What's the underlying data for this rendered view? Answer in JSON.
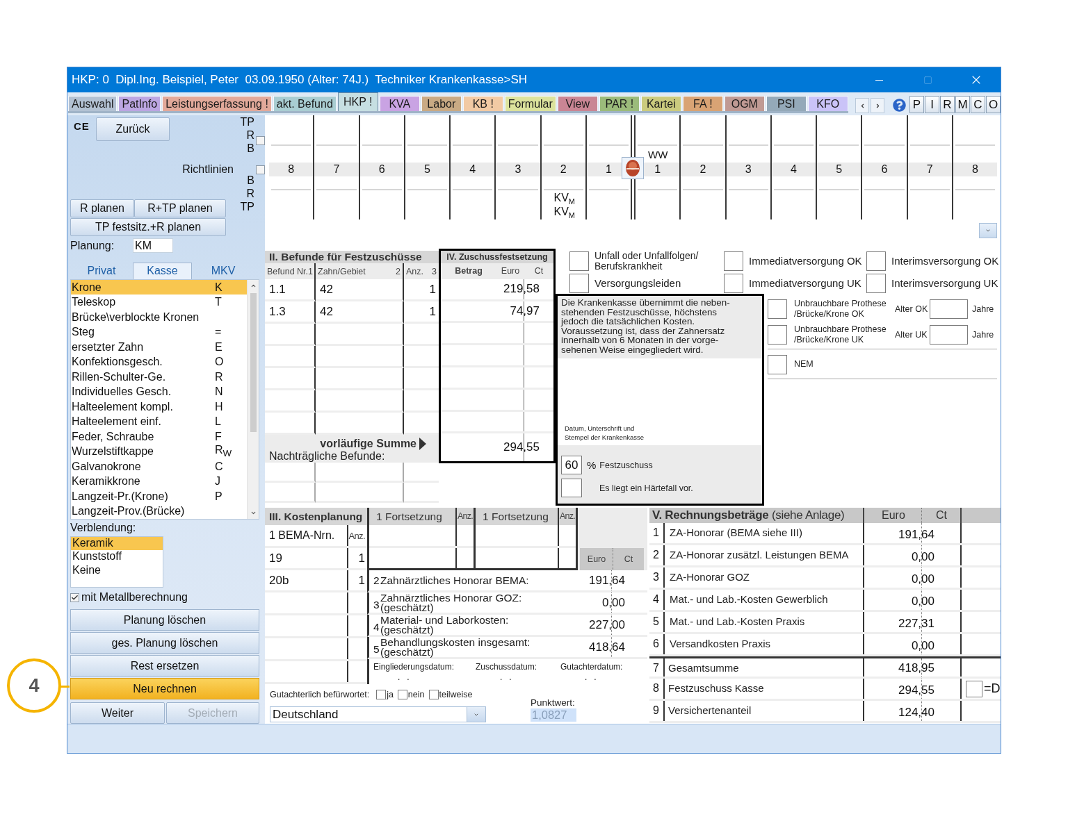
{
  "window": {
    "title": "HKP: 0  Dipl.Ing. Beispiel, Peter  03.09.1950 (Alter: 74J.)  Techniker Krankenkasse>SH"
  },
  "tabs": [
    {
      "label": "Auswahl",
      "color": "#b3c2d3",
      "selected": false
    },
    {
      "label": "PatInfo",
      "color": "#bca6e2",
      "selected": false
    },
    {
      "label": "Leistungserfassung !",
      "color": "#e2a99a",
      "selected": false
    },
    {
      "label": "akt. Befund",
      "color": "#a9cdd2",
      "selected": false
    },
    {
      "label": "HKP !",
      "color": "#c6dfe2",
      "selected": true
    },
    {
      "label": "KVA",
      "color": "#c9a3e3",
      "selected": false
    },
    {
      "label": "Labor",
      "color": "#c9aa84",
      "selected": false
    },
    {
      "label": "KB !",
      "color": "#f2caa4",
      "selected": false
    },
    {
      "label": "Formular",
      "color": "#dbe29c",
      "selected": false
    },
    {
      "label": "View",
      "color": "#c98594",
      "selected": false
    },
    {
      "label": "PAR !",
      "color": "#9bbb7b",
      "selected": false
    },
    {
      "label": "Kartei",
      "color": "#cbcb7e",
      "selected": false
    },
    {
      "label": "FA !",
      "color": "#d9a374",
      "selected": false
    },
    {
      "label": "OGM",
      "color": "#c09a94",
      "selected": false
    },
    {
      "label": "PSI",
      "color": "#94a9b9",
      "selected": false
    },
    {
      "label": "KFO",
      "color": "#cac3f8",
      "selected": false
    }
  ],
  "side_buttons": [
    "P",
    "I",
    "R",
    "M",
    "C",
    "O"
  ],
  "left_panel": {
    "ce_mark": "CE",
    "back_button": "Zurück",
    "upper_labels": [
      "TP",
      "R",
      "B"
    ],
    "upper_checkbox": {
      "checked": false
    },
    "guidelines": {
      "label": "Richtlinien",
      "checked": false
    },
    "lower_labels": [
      "B",
      "R",
      "TP"
    ],
    "plan_buttons": [
      "R planen",
      "R+TP planen",
      "TP festsitz.+R planen"
    ],
    "planning": {
      "label": "Planung:",
      "value": "KM"
    },
    "list_tabs": [
      {
        "label": "Privat",
        "selected": false
      },
      {
        "label": "Kasse",
        "selected": true
      },
      {
        "label": "MKV",
        "selected": false
      }
    ],
    "items": [
      {
        "name": "Krone",
        "code": "K",
        "selected": true
      },
      {
        "name": "Teleskop",
        "code": "T",
        "selected": false
      },
      {
        "name": "Brücke\\verblockte Kronen",
        "selected": false
      },
      {
        "name": "Steg",
        "code": "=",
        "selected": false
      },
      {
        "name": "ersetzter Zahn",
        "code": "E",
        "selected": false
      },
      {
        "name": "Konfektionsgesch.",
        "code": "O",
        "selected": false
      },
      {
        "name": "Rillen-Schulter-Ge.",
        "code": "R",
        "selected": false
      },
      {
        "name": "Individuelles Gesch.",
        "code": "N",
        "selected": false
      },
      {
        "name": "Halteelement kompl.",
        "code": "H",
        "selected": false
      },
      {
        "name": "Halteelement einf.",
        "code": "L",
        "selected": false
      },
      {
        "name": "Feder, Schraube",
        "code": "F",
        "selected": false
      },
      {
        "name": "Wurzelstiftkappe",
        "code": "R$_{W}$",
        "selected": false
      },
      {
        "name": "Galvanokrone",
        "code": "C",
        "selected": false
      },
      {
        "name": "Keramikkrone",
        "code": "J",
        "selected": false
      },
      {
        "name": "Langzeit-Pr.(Krone)",
        "code": "P",
        "selected": false
      },
      {
        "name": "Langzeit-Prov.(Brücke)",
        "selected": false
      }
    ],
    "veneer": {
      "label": "Verblendung:",
      "options": [
        {
          "label": "Keramik",
          "selected": true
        },
        {
          "label": "Kunststoff",
          "selected": false
        },
        {
          "label": "Keine",
          "selected": false
        }
      ]
    },
    "metal": {
      "label": "mit Metallberechnung",
      "checked": true
    },
    "actions": [
      {
        "label": "Planung löschen",
        "kind": "normal"
      },
      {
        "label": "ges. Planung löschen",
        "kind": "normal"
      },
      {
        "label": "Rest ersetzen",
        "kind": "normal"
      },
      {
        "label": "Neu rechnen",
        "kind": "highlight"
      }
    ],
    "footer_buttons": [
      {
        "label": "Weiter",
        "disabled": false
      },
      {
        "label": "Speichern",
        "disabled": true
      }
    ]
  },
  "tooth_chart": {
    "teeth": [
      {
        "number": "8"
      },
      {
        "number": "7"
      },
      {
        "number": "6"
      },
      {
        "number": "5"
      },
      {
        "number": "4"
      },
      {
        "number": "3"
      },
      {
        "number": "2",
        "lower_marks": [
          "KV$_{M}$",
          "KV$_{M}$"
        ]
      },
      {
        "number": "1"
      },
      {
        "number": "1",
        "upper_mark": "WW"
      },
      {
        "number": "2"
      },
      {
        "number": "3"
      },
      {
        "number": "4"
      },
      {
        "number": "5"
      },
      {
        "number": "6"
      },
      {
        "number": "7"
      },
      {
        "number": "8"
      }
    ]
  },
  "findings": {
    "title": "II. Befunde für Festzuschüsse",
    "columns": [
      {
        "label": "Befund Nr.",
        "number": "1"
      },
      {
        "label": "Zahn/Gebiet",
        "number": "2"
      },
      {
        "label": "Anz.",
        "number": "3"
      }
    ],
    "rows": [
      {
        "nr": "1.1",
        "tooth": "42",
        "count": "1",
        "amount": "219,58"
      },
      {
        "nr": "1.3",
        "tooth": "42",
        "count": "1",
        "amount": "74,97"
      }
    ],
    "sum_label": "vorläufige Summe",
    "sum": "294,55",
    "later_label": "Nachträgliche Befunde:"
  },
  "subsidy_box": {
    "title": "IV. Zuschussfestsetzung",
    "columns": [
      "Betrag",
      "Euro",
      "Ct"
    ]
  },
  "indications": [
    {
      "label": "Unfall oder Unfallfolgen/ Berufskrankheit",
      "checked": false
    },
    {
      "label": "Immediatversorgung OK",
      "checked": false
    },
    {
      "label": "Interimsversorgung OK",
      "checked": false
    },
    {
      "label": "Versorgungsleiden",
      "checked": false
    },
    {
      "label": "Immediatversorgung UK",
      "checked": false
    },
    {
      "label": "Interimsversorgung UK",
      "checked": false
    }
  ],
  "insurer_note": {
    "text": "Die Krankenkasse übernimmt die neben-\nstehenden Festzuschüsse, höchstens\njedoch die tatsächlichen Kosten.\nVoraussetzung ist, dass der Zahnersatz\ninnerhalb von 6 Monaten in der vorge-\nsehenen Weise eingegliedert wird.",
    "signature": "Datum, Unterschrift und\nStempel der Krankenkasse",
    "percent": "60",
    "percent_sign": "%",
    "percent_label": "Festzuschuss",
    "hardship": {
      "label": "Es liegt ein Härtefall vor.",
      "checked": false
    }
  },
  "prostheses": [
    {
      "label": "Unbrauchbare Prothese\n/Brücke/Krone OK",
      "checked": false,
      "age_label": "Alter OK",
      "unit": "Jahre"
    },
    {
      "label": "Unbrauchbare Prothese\n/Brücke/Krone UK",
      "checked": false,
      "age_label": "Alter UK",
      "unit": "Jahre"
    }
  ],
  "nem": {
    "label": "NEM",
    "checked": false
  },
  "cost_planning": {
    "title": "III. Kostenplanung",
    "bema_header": "1 BEMA-Nrn.",
    "count_header": "Anz.",
    "rows": [
      {
        "code": "19",
        "count": "1"
      },
      {
        "code": "20b",
        "count": "1"
      }
    ],
    "continuations": [
      {
        "title": "1 Fortsetzung",
        "count_header": "Anz."
      },
      {
        "title": "1 Fortsetzung",
        "count_header": "Anz."
      }
    ],
    "euro_header": "Euro",
    "ct_header": "Ct",
    "costs": [
      {
        "number": "2",
        "label": "Zahnärztliches Honorar BEMA:",
        "amount": "191,64"
      },
      {
        "number": "3",
        "label": "Zahnärztliches Honorar GOZ:",
        "note": "(geschätzt)",
        "amount": "0,00"
      },
      {
        "number": "4",
        "label": "Material- und Laborkosten:",
        "note": "(geschätzt)",
        "amount": "227,00"
      },
      {
        "number": "5",
        "label": "Behandlungskosten insgesamt:",
        "note": "(geschätzt)",
        "amount": "418,64"
      }
    ],
    "dates": [
      {
        "label": "Eingliederungsdatum:",
        "value": ".   ."
      },
      {
        "label": "Zuschussdatum:",
        "value": ".   ."
      },
      {
        "label": "Gutachterdatum:",
        "value": ".   ."
      }
    ],
    "approval": {
      "label": "Gutachterlich befürwortet:",
      "options": [
        {
          "label": "ja",
          "checked": false
        },
        {
          "label": "nein",
          "checked": false
        },
        {
          "label": "teilweise",
          "checked": false
        }
      ]
    },
    "country": "Deutschland",
    "point_value": {
      "label": "Punktwert:",
      "value": "1,0827"
    }
  },
  "billing": {
    "title": "**V. Rechnungsbeträge** (siehe Anlage)",
    "euro_header": "Euro",
    "ct_header": "Ct",
    "rows": [
      {
        "number": "1",
        "label": "ZA-Honorar (BEMA siehe III)",
        "amount": "191,64",
        "kind": "item"
      },
      {
        "number": "2",
        "label": "ZA-Honorar zusätzl. Leistungen BEMA",
        "amount": "0,00",
        "kind": "item"
      },
      {
        "number": "3",
        "label": "ZA-Honorar GOZ",
        "amount": "0,00",
        "kind": "item"
      },
      {
        "number": "4",
        "label": "Mat.- und Lab.-Kosten Gewerblich",
        "amount": "0,00",
        "kind": "item"
      },
      {
        "number": "5",
        "label": "Mat.- und Lab.-Kosten Praxis",
        "amount": "227,31",
        "kind": "item"
      },
      {
        "number": "6",
        "label": "Versandkosten Praxis",
        "amount": "0,00",
        "kind": "item"
      },
      {
        "number": "7",
        "label": "Gesamtsumme",
        "amount": "418,95",
        "kind": "total"
      },
      {
        "number": "8",
        "label": "Festzuschuss Kasse",
        "amount": "294,55",
        "kind": "total",
        "flag": {
          "label": "=D",
          "checked": false
        }
      },
      {
        "number": "9",
        "label": "Versichertenanteil",
        "amount": "124,40",
        "kind": "total"
      }
    ]
  },
  "callout": {
    "label": "4"
  }
}
